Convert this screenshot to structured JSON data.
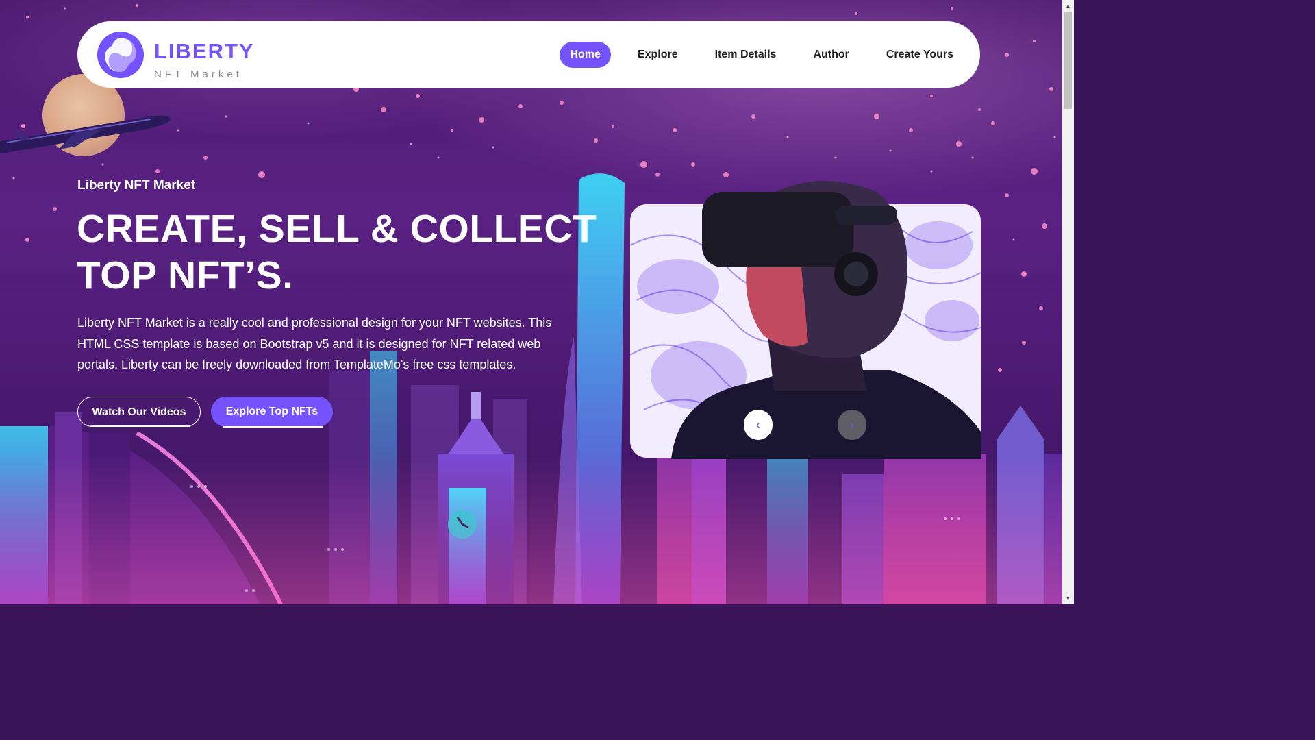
{
  "brand": {
    "name": "LIBERTY",
    "tagline": "NFT Market",
    "accent": "#7453fc"
  },
  "nav": {
    "items": [
      {
        "label": "Home",
        "active": true
      },
      {
        "label": "Explore",
        "active": false
      },
      {
        "label": "Item Details",
        "active": false
      },
      {
        "label": "Author",
        "active": false
      },
      {
        "label": "Create Yours",
        "active": false
      }
    ]
  },
  "hero": {
    "kicker": "Liberty NFT Market",
    "title_line1": "CREATE, SELL & COLLECT",
    "title_line2": "TOP NFT’S.",
    "description": "Liberty NFT Market is a really cool and professional design for your NFT websites. This HTML CSS template is based on Bootstrap v5 and it is designed for NFT related web portals. Liberty can be freely downloaded from TemplateMo's free css templates.",
    "primary_button": "Explore Top NFTs",
    "secondary_button": "Watch Our Videos"
  },
  "slider": {
    "prev_icon": "chevron-left-icon",
    "next_icon": "chevron-right-icon",
    "prev_glyph": "‹",
    "next_glyph": "›"
  },
  "scrollbar": {
    "up_glyph": "▲",
    "down_glyph": "▼"
  }
}
